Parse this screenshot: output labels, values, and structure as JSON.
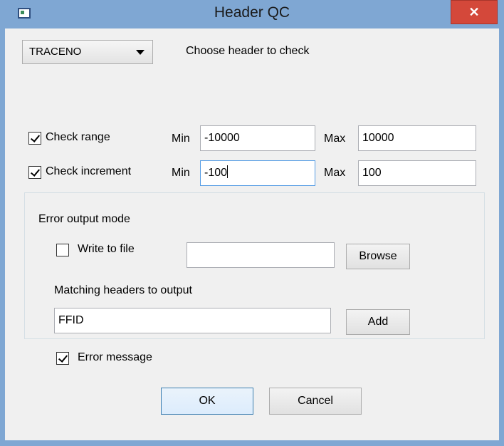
{
  "window": {
    "title": "Header QC",
    "close_glyph": "✕"
  },
  "header_select": {
    "value": "TRACENO",
    "caption": "Choose header to check"
  },
  "check_range": {
    "checked": true,
    "label": "Check range",
    "min_label": "Min",
    "min_value": "-10000",
    "max_label": "Max",
    "max_value": "10000"
  },
  "check_increment": {
    "checked": true,
    "label": "Check increment",
    "min_label": "Min",
    "min_value": "-100",
    "max_label": "Max",
    "max_value": "100"
  },
  "error_output": {
    "group_title": "Error output mode",
    "write_to_file": {
      "checked": false,
      "label": "Write to file",
      "path_value": ""
    },
    "browse_label": "Browse",
    "matching_label": "Matching headers to output",
    "matching_value": "FFID",
    "add_label": "Add",
    "error_message": {
      "checked": true,
      "label": "Error message"
    }
  },
  "buttons": {
    "ok_label": "OK",
    "cancel_label": "Cancel"
  },
  "colors": {
    "titlebar": "#7fa7d3",
    "close_button": "#d4483a",
    "dialog_background": "#f0f0f0",
    "focus_border": "#569de5"
  }
}
